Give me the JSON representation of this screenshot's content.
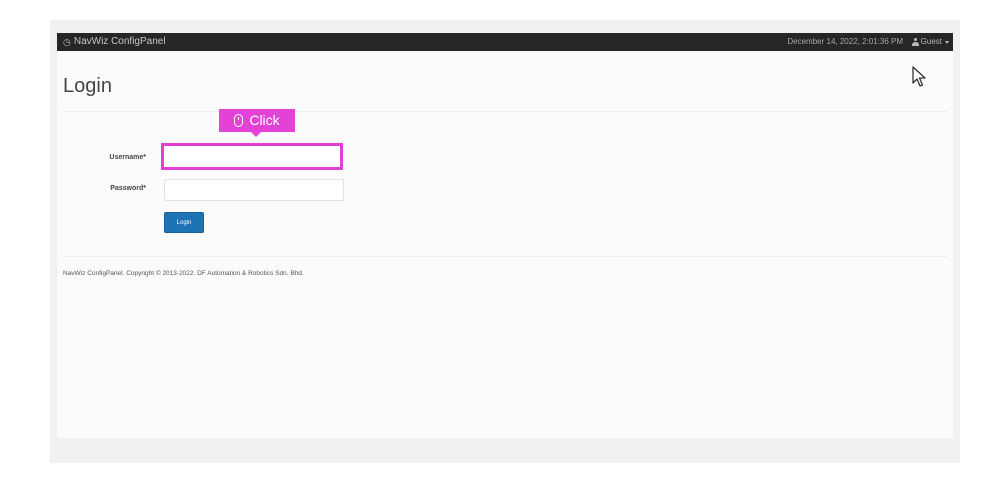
{
  "navbar": {
    "brand_icon": "tachometer-icon",
    "brand": "NavWiz ConfigPanel",
    "datetime": "December 14, 2022, 2:01:36 PM",
    "user_icon": "user-icon",
    "user": "Guest"
  },
  "page": {
    "title": "Login"
  },
  "form": {
    "username_label": "Username*",
    "username_value": "",
    "password_label": "Password*",
    "password_value": "",
    "login_label": "Login"
  },
  "annotation": {
    "click_label": "Click",
    "click_icon": "mouse-icon",
    "highlight_color": "#e23fd4"
  },
  "footer": {
    "text": "NavWiz ConfigPanel. Copyright © 2013-2022. DF Automation & Robotics Sdn. Bhd."
  },
  "colors": {
    "navbar_bg": "#262626",
    "button_bg": "#1e73b5",
    "badge_bg": "#e441d6"
  }
}
